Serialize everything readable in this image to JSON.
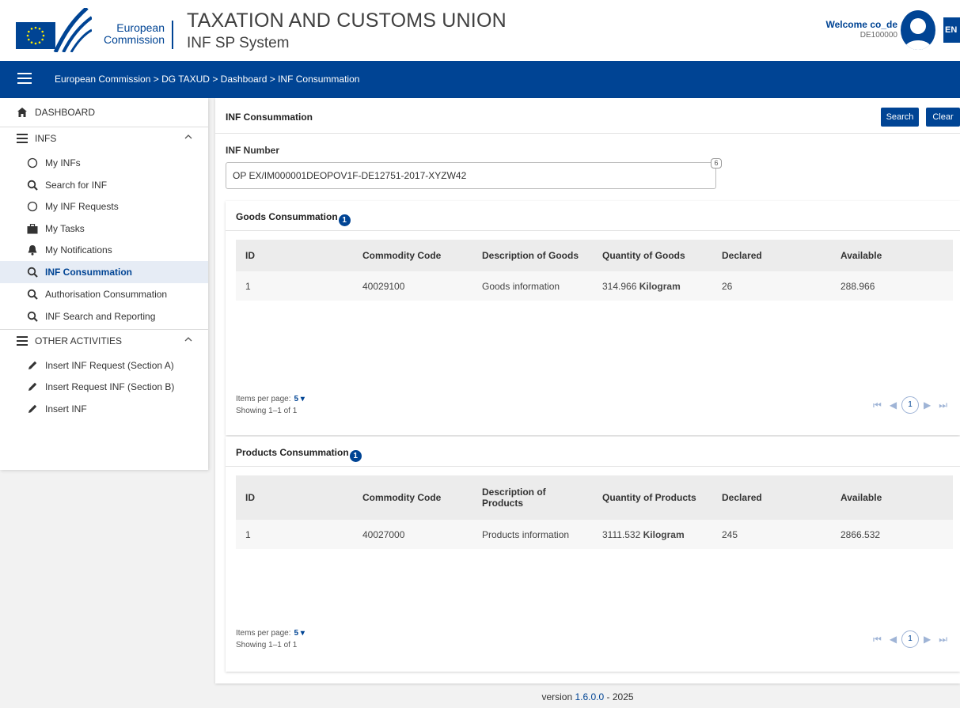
{
  "header": {
    "ec_name_line1": "European",
    "ec_name_line2": "Commission",
    "title": "TAXATION AND CUSTOMS UNION",
    "subtitle": "INF SP System",
    "welcome": "Welcome co_de",
    "user_id": "DE100000",
    "language": "EN"
  },
  "topbar": {
    "breadcrumb": [
      "European Commission",
      "DG TAXUD",
      "Dashboard",
      "INF Consummation"
    ],
    "separator": ">"
  },
  "sidebar": {
    "dashboard": "DASHBOARD",
    "infs_section": "INFS",
    "infs_items": [
      {
        "label": "My INFs",
        "icon": "circle-icon"
      },
      {
        "label": "Search for INF",
        "icon": "search-icon"
      },
      {
        "label": "My INF Requests",
        "icon": "circle-icon"
      },
      {
        "label": "My Tasks",
        "icon": "briefcase-icon"
      },
      {
        "label": "My Notifications",
        "icon": "bell-icon"
      },
      {
        "label": "INF Consummation",
        "icon": "search-icon",
        "active": true
      },
      {
        "label": "Authorisation Consummation",
        "icon": "search-icon"
      },
      {
        "label": "INF Search and Reporting",
        "icon": "search-icon"
      }
    ],
    "other_section": "OTHER ACTIVITIES",
    "other_items": [
      {
        "label": "Insert INF Request (Section A)",
        "icon": "pencil-icon"
      },
      {
        "label": "Insert Request INF (Section B)",
        "icon": "pencil-icon"
      },
      {
        "label": "Insert INF",
        "icon": "pencil-icon"
      }
    ]
  },
  "main": {
    "title": "INF Consummation",
    "search_label": "Search",
    "clear_label": "Clear",
    "inf_number_label": "INF Number",
    "inf_number_value": "OP EX/IM000001DEOPOV1F-DE12751-2017-XYZW42",
    "inf_number_count": "6"
  },
  "goods": {
    "title": "Goods Consummation",
    "count": "1",
    "headers": [
      "ID",
      "Commodity Code",
      "Description of Goods",
      "Quantity of Goods",
      "Declared",
      "Available"
    ],
    "rows": [
      {
        "id": "1",
        "commodity": "40029100",
        "description": "Goods information",
        "quantity": "314.966",
        "unit": "Kilogram",
        "declared": "26",
        "available": "288.966"
      }
    ],
    "items_per_page_label": "Items per page:",
    "items_per_page": "5",
    "showing": "Showing 1–1 of 1",
    "page": "1"
  },
  "products": {
    "title": "Products Consummation",
    "count": "1",
    "headers": [
      "ID",
      "Commodity Code",
      "Description of Products",
      "Quantity of Products",
      "Declared",
      "Available"
    ],
    "rows": [
      {
        "id": "1",
        "commodity": "40027000",
        "description": "Products information",
        "quantity": "3111.532",
        "unit": "Kilogram",
        "declared": "245",
        "available": "2866.532"
      }
    ],
    "items_per_page_label": "Items per page:",
    "items_per_page": "5",
    "showing": "Showing 1–1 of 1",
    "page": "1"
  },
  "footer": {
    "prefix": "version ",
    "version": "1.6.0.0",
    "suffix": " - 2025"
  },
  "colors": {
    "brand": "#004494",
    "active_bg": "#e6ecf5"
  }
}
